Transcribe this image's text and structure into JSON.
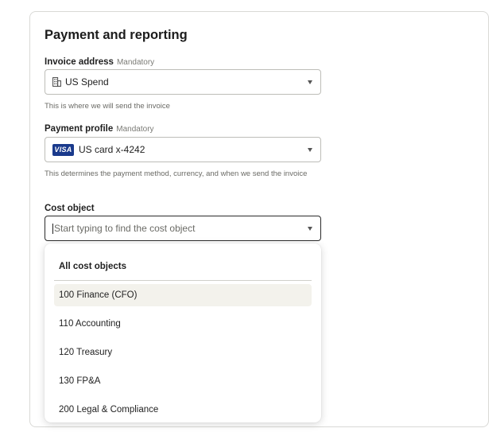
{
  "section_title": "Payment and reporting",
  "invoice_address": {
    "label": "Invoice address",
    "mandatory": "Mandatory",
    "value": "US Spend",
    "icon": "building-icon",
    "helper": "This is where we will send the invoice"
  },
  "payment_profile": {
    "label": "Payment profile",
    "mandatory": "Mandatory",
    "card_brand": "VISA",
    "value": "US card x-4242",
    "icon": "visa-card-icon",
    "helper": "This determines the payment method, currency, and when we send the invoice"
  },
  "cost_object": {
    "label": "Cost object",
    "placeholder": "Start typing to find the cost object",
    "value": ""
  },
  "dropdown": {
    "header": "All cost objects",
    "options": [
      "100 Finance (CFO)",
      "110 Accounting",
      "120 Treasury",
      "130 FP&A",
      "200 Legal & Compliance"
    ],
    "highlighted_index": 0
  },
  "colors": {
    "visa_blue": "#1a3a8c",
    "highlight_bg": "#f3f2ec",
    "border": "#bdbdb8"
  }
}
